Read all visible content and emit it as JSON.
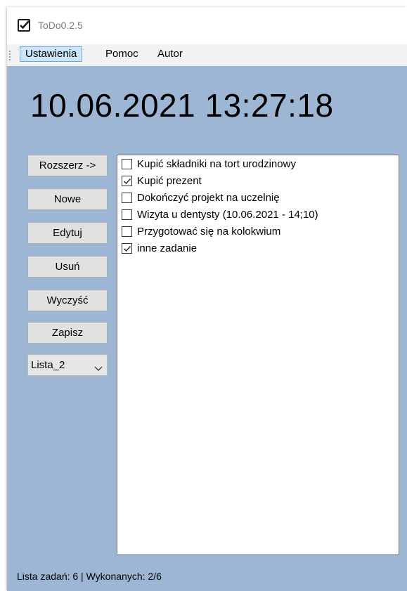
{
  "window": {
    "title": "ToDo0.2.5"
  },
  "menu": {
    "items": [
      "Ustawienia",
      "Pomoc",
      "Autor"
    ]
  },
  "clock": "10.06.2021 13:27:18",
  "buttons": {
    "expand": "Rozszerz ->",
    "new": "Nowe",
    "edit": "Edytuj",
    "delete": "Usuń",
    "clear": "Wyczyść",
    "save": "Zapisz"
  },
  "list_select": {
    "value": "Lista_2"
  },
  "tasks": [
    {
      "text": "Kupić składniki na tort urodzinowy",
      "checked": false
    },
    {
      "text": "Kupić prezent",
      "checked": true
    },
    {
      "text": "Dokończyć projekt na uczelnię",
      "checked": false
    },
    {
      "text": "Wizyta u dentysty (10.06.2021 - 14;10)",
      "checked": false
    },
    {
      "text": "Przygotować się na kolokwium",
      "checked": false
    },
    {
      "text": "inne zadanie",
      "checked": true
    }
  ],
  "status": "Lista zadań: 6 | Wykonanych: 2/6",
  "icons": {
    "app": "checkmark-icon",
    "dropdown": "chevron-down-icon",
    "check": "check-icon"
  },
  "colors": {
    "client_bg": "#9db6d3",
    "menu_active": "#cce4f7"
  }
}
